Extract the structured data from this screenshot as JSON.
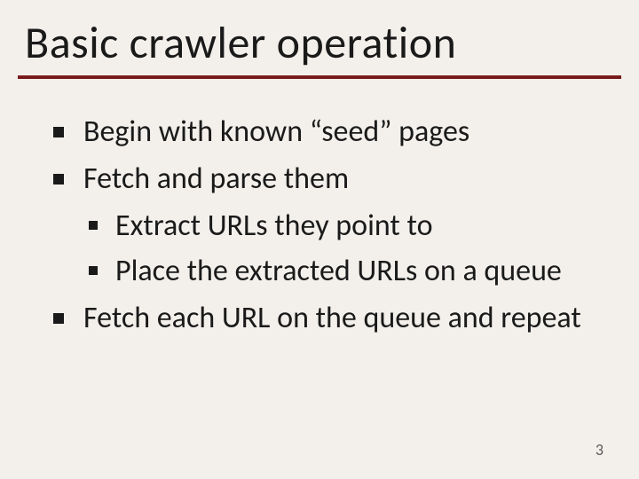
{
  "title": "Basic crawler operation",
  "bullets": {
    "b1": "Begin with known “seed” pages",
    "b2": "Fetch and parse them",
    "b2a": "Extract URLs they point to",
    "b2b": "Place the extracted URLs on a queue",
    "b3": "Fetch each URL on the queue and repeat"
  },
  "page_number": "3"
}
